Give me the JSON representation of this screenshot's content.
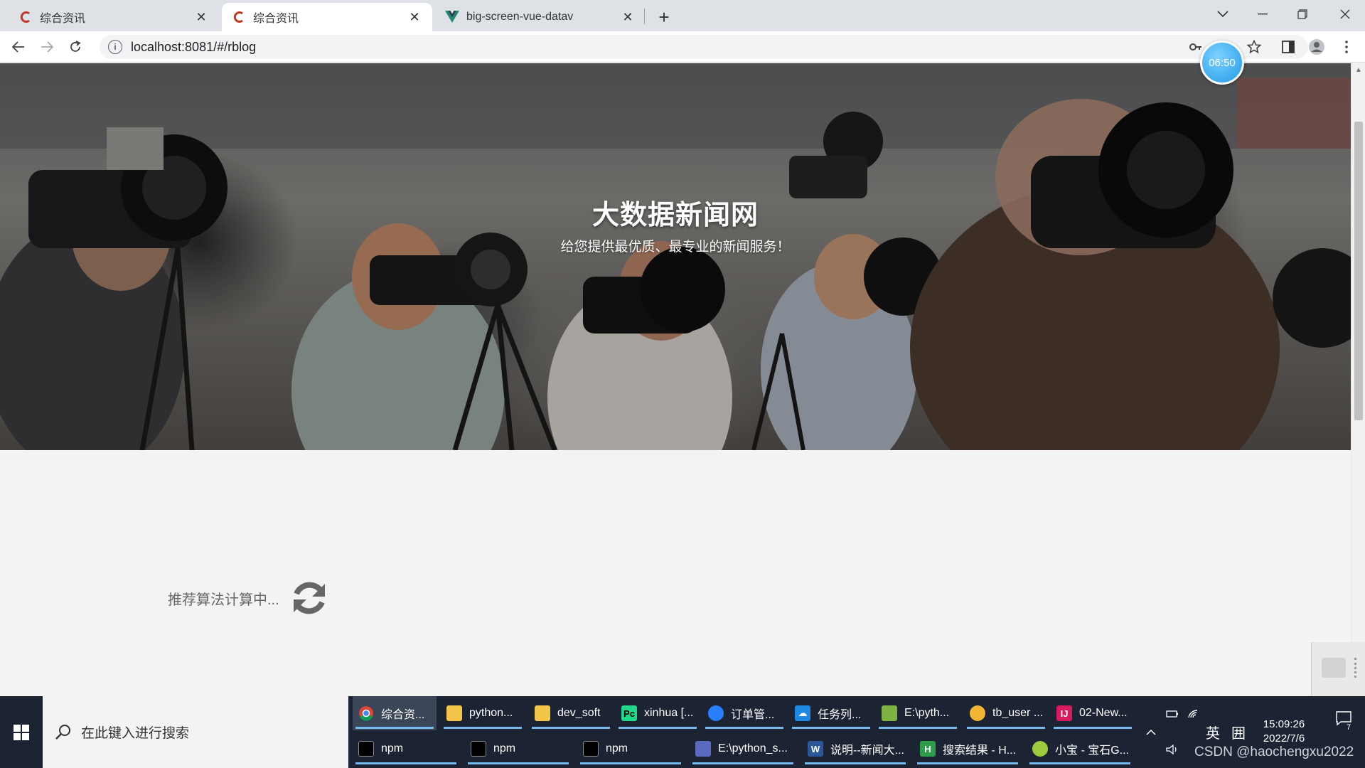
{
  "browser": {
    "tabs": [
      {
        "title": "综合资讯",
        "active": false,
        "icon": "c-logo-icon"
      },
      {
        "title": "综合资讯",
        "active": true,
        "icon": "c-logo-icon"
      },
      {
        "title": "big-screen-vue-datav",
        "active": false,
        "icon": "vue-logo-icon"
      }
    ],
    "url": "localhost:8081/#/rblog",
    "timer_badge": "06:50"
  },
  "page": {
    "hero_title": "大数据新闻网",
    "hero_subtitle": "给您提供最优质、最专业的新闻服务！",
    "loading_text": "推荐算法计算中...",
    "accent_color": "#1e9be8"
  },
  "taskbar": {
    "search_placeholder": "在此键入进行搜索",
    "row1": [
      {
        "label": "综合资...",
        "icon": "chrome-icon",
        "active": true
      },
      {
        "label": "python...",
        "icon": "folder-icon"
      },
      {
        "label": "dev_soft",
        "icon": "folder-icon"
      },
      {
        "label": "xinhua [...",
        "icon": "pycharm-icon"
      },
      {
        "label": "订单管...",
        "icon": "qq-browser-icon"
      },
      {
        "label": "任务列...",
        "icon": "cloud-icon"
      },
      {
        "label": "E:\\pyth...",
        "icon": "image-viewer-icon"
      },
      {
        "label": "tb_user ...",
        "icon": "navicat-icon"
      },
      {
        "label": "02-New...",
        "icon": "intellij-icon"
      }
    ],
    "row2": [
      {
        "label": "npm",
        "icon": "terminal-icon"
      },
      {
        "label": "npm",
        "icon": "terminal-icon"
      },
      {
        "label": "npm",
        "icon": "terminal-icon"
      },
      {
        "label": "E:\\python_s...",
        "icon": "window-icon"
      },
      {
        "label": "说明--新闻大...",
        "icon": "word-icon"
      },
      {
        "label": "搜索结果 - H...",
        "icon": "hbuilder-icon"
      },
      {
        "label": "小宝 - 宝石G...",
        "icon": "game-icon"
      }
    ],
    "ime_lang": "英",
    "ime_mode": "囲",
    "time": "15:09:26",
    "date": "2022/7/6",
    "notification_count": "7",
    "watermark": "CSDN @haochengxu2022"
  }
}
